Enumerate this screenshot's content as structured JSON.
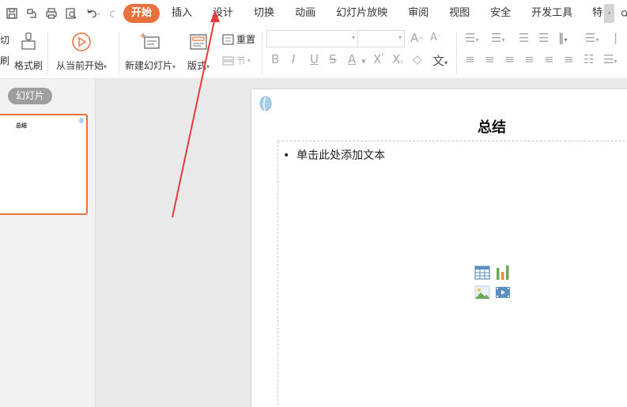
{
  "quick_access": {
    "icons": [
      "save-icon",
      "save-as-icon",
      "print-icon",
      "print-preview-icon",
      "undo-icon",
      "redo-icon"
    ]
  },
  "menu": {
    "tabs": [
      {
        "label": "开始",
        "active": true
      },
      {
        "label": "插入"
      },
      {
        "label": "设计"
      },
      {
        "label": "切换"
      },
      {
        "label": "动画"
      },
      {
        "label": "幻灯片放映"
      },
      {
        "label": "审阅"
      },
      {
        "label": "视图"
      },
      {
        "label": "安全"
      },
      {
        "label": "开发工具"
      },
      {
        "label": "特"
      }
    ],
    "more_label": "›",
    "search_label": "查找"
  },
  "ribbon": {
    "cut_label": "切",
    "brush_cut_label": "刷",
    "format_painter_label": "格式刷",
    "from_current_label": "从当前开始",
    "new_slide_label": "新建幻灯片",
    "layout_label": "版式",
    "reset_label": "重置",
    "section_label": "节"
  },
  "slides_pane": {
    "tab_label": "幻灯片",
    "thumb_title": "总结"
  },
  "slide": {
    "title": "总结",
    "placeholder_text": "单击此处添加文本"
  },
  "colors": {
    "accent": "#e8703c",
    "arrow": "#e53b3b"
  }
}
